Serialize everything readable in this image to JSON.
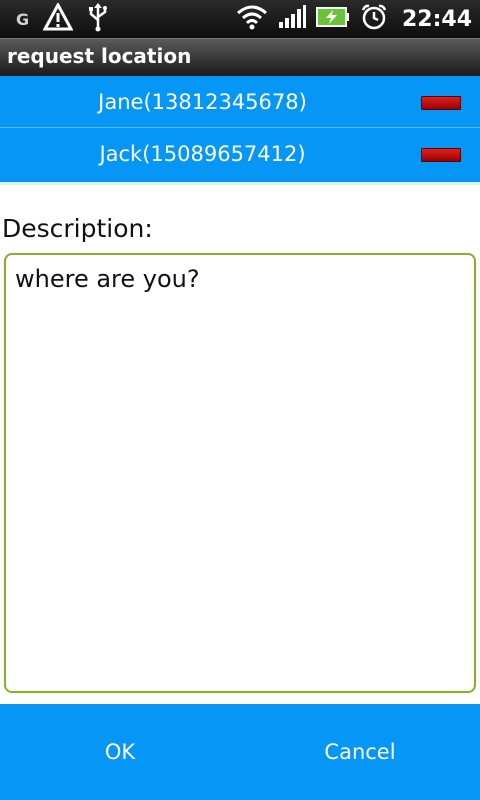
{
  "status_bar": {
    "left_icons": [
      "g-icon",
      "warning-icon",
      "usb-icon"
    ],
    "right_icons": [
      "wifi-icon",
      "signal-icon",
      "battery-charging-icon",
      "alarm-icon"
    ],
    "g_label": "G",
    "time": "22:44"
  },
  "title_bar": {
    "title": "request location"
  },
  "contacts": [
    {
      "label": "Jane(13812345678)"
    },
    {
      "label": "Jack(15089657412)"
    }
  ],
  "description": {
    "label": "Description:",
    "value": "where are you?"
  },
  "buttons": {
    "ok_label": "OK",
    "cancel_label": "Cancel"
  },
  "colors": {
    "accent_blue": "#0596f6",
    "remove_red": "#c40000",
    "input_border": "#86b226"
  }
}
